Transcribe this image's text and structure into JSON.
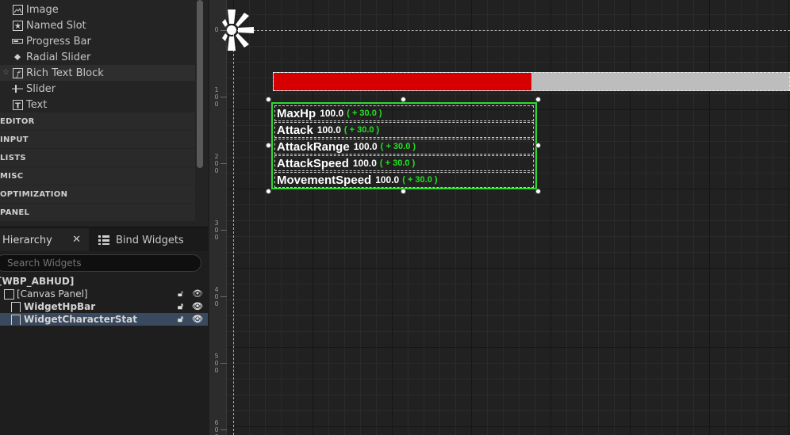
{
  "palette": {
    "items": [
      {
        "label": "Image",
        "icon": "image-icon"
      },
      {
        "label": "Named Slot",
        "icon": "named-slot-icon"
      },
      {
        "label": "Progress Bar",
        "icon": "progress-bar-icon"
      },
      {
        "label": "Radial Slider",
        "icon": "radial-slider-icon"
      },
      {
        "label": "Rich Text Block",
        "icon": "rich-text-block-icon"
      },
      {
        "label": "Slider",
        "icon": "slider-icon"
      },
      {
        "label": "Text",
        "icon": "text-icon"
      }
    ],
    "categories": [
      "EDITOR",
      "INPUT",
      "LISTS",
      "MISC",
      "OPTIMIZATION",
      "PANEL"
    ]
  },
  "hierarchy": {
    "tab_label": "Hierarchy",
    "bind_tab_label": "Bind Widgets",
    "search_placeholder": "Search Widgets",
    "tree": [
      {
        "label": "[WBP_ABHUD]"
      },
      {
        "label": "[Canvas Panel]"
      },
      {
        "label": "WidgetHpBar"
      },
      {
        "label": "WidgetCharacterStat"
      }
    ]
  },
  "designer": {
    "ruler_labels": [
      "0",
      "100",
      "200",
      "300",
      "400",
      "500",
      "600"
    ],
    "hp_bar": {
      "percent": 0.5,
      "fill_color": "#d60000",
      "bg_color": "#bdbdbd"
    },
    "selection_color": "#2fd82f",
    "stats": [
      {
        "name": "MaxHp",
        "base": "100.0",
        "modifier": "( + 30.0 )"
      },
      {
        "name": "Attack",
        "base": "100.0",
        "modifier": "( + 30.0 )"
      },
      {
        "name": "AttackRange",
        "base": "100.0",
        "modifier": "( + 30.0 )"
      },
      {
        "name": "AttackSpeed",
        "base": "100.0",
        "modifier": "( + 30.0 )"
      },
      {
        "name": "MovementSpeed",
        "base": "100.0",
        "modifier": "( + 30.0 )"
      }
    ]
  }
}
